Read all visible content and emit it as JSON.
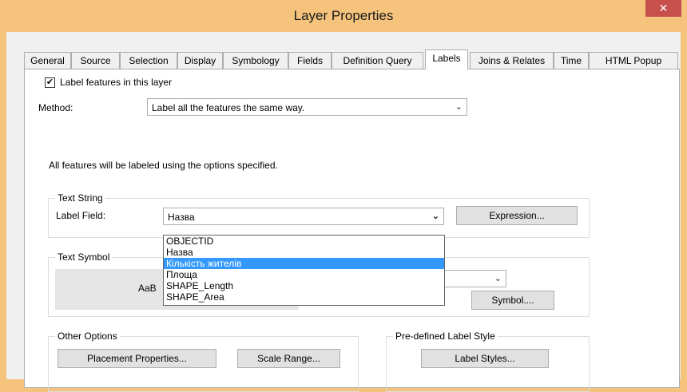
{
  "window": {
    "title": "Layer Properties",
    "close_glyph": "✕"
  },
  "tabs": [
    {
      "label": "General"
    },
    {
      "label": "Source"
    },
    {
      "label": "Selection"
    },
    {
      "label": "Display"
    },
    {
      "label": "Symbology"
    },
    {
      "label": "Fields"
    },
    {
      "label": "Definition Query"
    },
    {
      "label": "Labels",
      "active": true
    },
    {
      "label": "Joins & Relates"
    },
    {
      "label": "Time"
    },
    {
      "label": "HTML Popup"
    }
  ],
  "labels_tab": {
    "label_features_checkbox": {
      "label": "Label features in this layer",
      "checked": true,
      "glyph": "✔"
    },
    "method": {
      "label": "Method:",
      "value": "Label all the features the same way."
    },
    "info_text": "All features will be labeled using the options specified.",
    "text_string": {
      "group_title": "Text String",
      "label_field_label": "Label Field:",
      "label_field_value": "Назва",
      "expression_button": "Expression..."
    },
    "label_field_dropdown": {
      "options": [
        "OBJECTID",
        "Назва",
        "Кількість жителів",
        "Площа",
        "SHAPE_Length",
        "SHAPE_Area"
      ],
      "selected_index": 2
    },
    "text_symbol": {
      "group_title": "Text Symbol",
      "preview_text": "AaB",
      "symbol_button": "Symbol...."
    },
    "other_options": {
      "group_title": "Other Options",
      "placement_button": "Placement Properties...",
      "scale_button": "Scale Range..."
    },
    "predefined_style": {
      "group_title": "Pre-defined Label Style",
      "label_styles_button": "Label Styles..."
    }
  },
  "icons": {
    "dropdown_arrow": "chevron-down-icon",
    "close": "close-icon",
    "check": "checkmark-icon"
  },
  "colors": {
    "titlebar": "#f5c37c",
    "close_button": "#c7504d",
    "selection": "#3399ff"
  }
}
